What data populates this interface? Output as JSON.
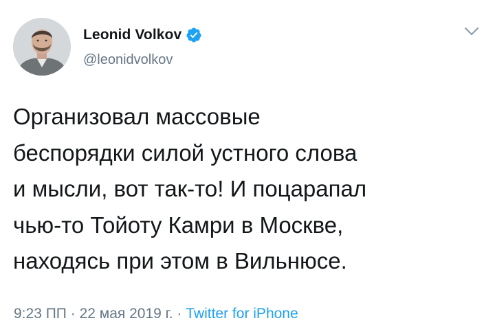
{
  "author": {
    "display_name": "Leonid Volkov",
    "handle": "@leonidvolkov",
    "verified": true,
    "avatar_icon": "profile-photo"
  },
  "menu": {
    "icon": "chevron-down-icon"
  },
  "tweet": {
    "lines": [
      "Организовал массовые",
      "беспорядки силой устного слова",
      "и мысли, вот так-то! И поцарапал",
      "чью-то Тойоту Камри в Москве,",
      "находясь при этом в Вильнюсе."
    ]
  },
  "meta": {
    "time": "9:23 ПП",
    "separator": " · ",
    "date": "22 мая 2019 г.",
    "source": "Twitter for iPhone"
  },
  "colors": {
    "text": "#14171a",
    "secondary": "#657786",
    "accent": "#1da1f2"
  }
}
